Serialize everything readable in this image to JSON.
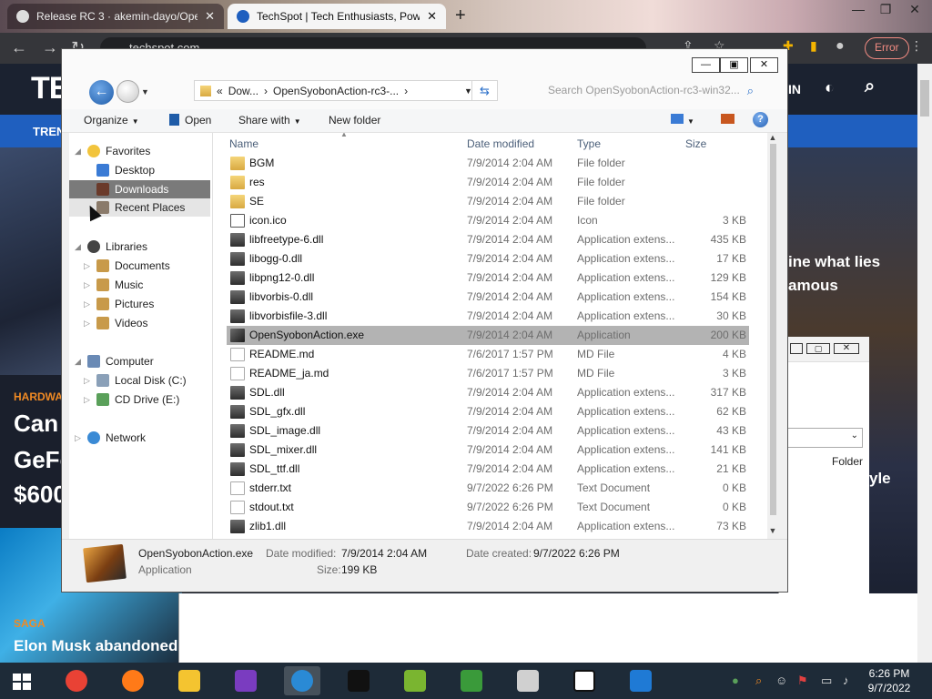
{
  "browser": {
    "tabs": [
      {
        "title": "Release RC 3 · akemin-dayo/Ope",
        "close": "✕"
      },
      {
        "title": "TechSpot | Tech Enthusiasts, Pow",
        "close": "✕"
      }
    ],
    "new_tab": "+",
    "url": "techspot.com",
    "error_label": "Error"
  },
  "site": {
    "logo": "TE",
    "nav_item": "TREN",
    "header_right": "IN",
    "headline_right_1": "ine what lies",
    "headline_right_2": "amous",
    "section_label": "HARDWA",
    "headline_left_1": "Can",
    "headline_left_2": "GeFo",
    "headline_left_3": "$600",
    "saga_label": "SAGA",
    "saga_headline": "Elon Musk abandoned",
    "right_word_1": "yle",
    "folder_col": "Folder"
  },
  "explorer": {
    "breadcrumb": [
      "«",
      "Dow...",
      "›",
      "OpenSyobonAction-rc3-...",
      "›"
    ],
    "search_placeholder": "Search OpenSyobonAction-rc3-win32...",
    "toolbar": {
      "organize": "Organize",
      "open": "Open",
      "share_with": "Share with",
      "new_folder": "New folder"
    },
    "nav": {
      "favorites": "Favorites",
      "desktop": "Desktop",
      "downloads": "Downloads",
      "recent_places": "Recent Places",
      "libraries": "Libraries",
      "documents": "Documents",
      "music": "Music",
      "pictures": "Pictures",
      "videos": "Videos",
      "computer": "Computer",
      "local_disk": "Local Disk (C:)",
      "cd_drive": "CD Drive (E:)",
      "network": "Network"
    },
    "columns": {
      "name": "Name",
      "date_modified": "Date modified",
      "type": "Type",
      "size": "Size"
    },
    "files": [
      {
        "name": "BGM",
        "date": "7/9/2014 2:04 AM",
        "type": "File folder",
        "size": "",
        "icon": "folder"
      },
      {
        "name": "res",
        "date": "7/9/2014 2:04 AM",
        "type": "File folder",
        "size": "",
        "icon": "folder"
      },
      {
        "name": "SE",
        "date": "7/9/2014 2:04 AM",
        "type": "File folder",
        "size": "",
        "icon": "folder"
      },
      {
        "name": "icon.ico",
        "date": "7/9/2014 2:04 AM",
        "type": "Icon",
        "size": "3 KB",
        "icon": "ico"
      },
      {
        "name": "libfreetype-6.dll",
        "date": "7/9/2014 2:04 AM",
        "type": "Application extens...",
        "size": "435 KB",
        "icon": "dll"
      },
      {
        "name": "libogg-0.dll",
        "date": "7/9/2014 2:04 AM",
        "type": "Application extens...",
        "size": "17 KB",
        "icon": "dll"
      },
      {
        "name": "libpng12-0.dll",
        "date": "7/9/2014 2:04 AM",
        "type": "Application extens...",
        "size": "129 KB",
        "icon": "dll"
      },
      {
        "name": "libvorbis-0.dll",
        "date": "7/9/2014 2:04 AM",
        "type": "Application extens...",
        "size": "154 KB",
        "icon": "dll"
      },
      {
        "name": "libvorbisfile-3.dll",
        "date": "7/9/2014 2:04 AM",
        "type": "Application extens...",
        "size": "30 KB",
        "icon": "dll"
      },
      {
        "name": "OpenSyobonAction.exe",
        "date": "7/9/2014 2:04 AM",
        "type": "Application",
        "size": "200 KB",
        "icon": "exe",
        "selected": true
      },
      {
        "name": "README.md",
        "date": "7/6/2017 1:57 PM",
        "type": "MD File",
        "size": "4 KB",
        "icon": "doc"
      },
      {
        "name": "README_ja.md",
        "date": "7/6/2017 1:57 PM",
        "type": "MD File",
        "size": "3 KB",
        "icon": "doc"
      },
      {
        "name": "SDL.dll",
        "date": "7/9/2014 2:04 AM",
        "type": "Application extens...",
        "size": "317 KB",
        "icon": "dll"
      },
      {
        "name": "SDL_gfx.dll",
        "date": "7/9/2014 2:04 AM",
        "type": "Application extens...",
        "size": "62 KB",
        "icon": "dll"
      },
      {
        "name": "SDL_image.dll",
        "date": "7/9/2014 2:04 AM",
        "type": "Application extens...",
        "size": "43 KB",
        "icon": "dll"
      },
      {
        "name": "SDL_mixer.dll",
        "date": "7/9/2014 2:04 AM",
        "type": "Application extens...",
        "size": "141 KB",
        "icon": "dll"
      },
      {
        "name": "SDL_ttf.dll",
        "date": "7/9/2014 2:04 AM",
        "type": "Application extens...",
        "size": "21 KB",
        "icon": "dll"
      },
      {
        "name": "stderr.txt",
        "date": "9/7/2022 6:26 PM",
        "type": "Text Document",
        "size": "0 KB",
        "icon": "doc"
      },
      {
        "name": "stdout.txt",
        "date": "9/7/2022 6:26 PM",
        "type": "Text Document",
        "size": "0 KB",
        "icon": "doc"
      },
      {
        "name": "zlib1.dll",
        "date": "7/9/2014 2:04 AM",
        "type": "Application extens...",
        "size": "73 KB",
        "icon": "dll"
      }
    ],
    "details": {
      "name": "OpenSyobonAction.exe",
      "kind": "Application",
      "date_modified_label": "Date modified:",
      "date_modified": "7/9/2014 2:04 AM",
      "date_created_label": "Date created:",
      "date_created": "9/7/2022 6:26 PM",
      "size_label": "Size:",
      "size": "199 KB"
    }
  },
  "taskbar": {
    "time": "6:26 PM",
    "date": "9/7/2022",
    "apps": [
      "chrome-icon",
      "firefox-icon",
      "file-explorer-icon",
      "yahoo-messenger-icon",
      "internet-explorer-icon",
      "command-prompt-icon",
      "notepad-plus-icon",
      "frog-app-icon",
      "paint-tools-icon",
      "7zip-icon",
      "blue-app-icon"
    ]
  }
}
